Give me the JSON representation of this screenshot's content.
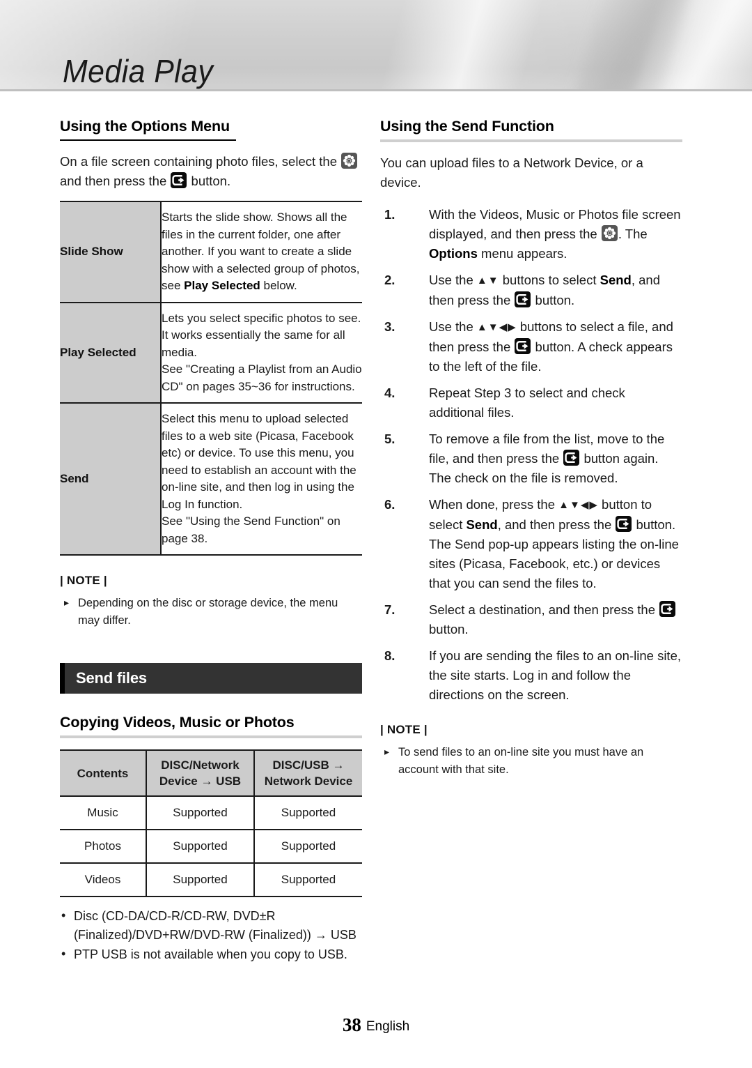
{
  "header": {
    "chapter_title": "Media Play"
  },
  "icons": {
    "gear": "gear-icon",
    "enter": "enter-icon",
    "arrow_updown": "▲▼",
    "arrow_all": "▲▼◀▶",
    "arrow_right": "→"
  },
  "left_column": {
    "heading": "Using the Options Menu",
    "intro_part1": "On a file screen containing photo files, select the",
    "intro_part2": "and then press the",
    "intro_part3": "button.",
    "options_table": {
      "rows": [
        {
          "label": "Slide Show",
          "desc_lead": "Starts the slide show. Shows all the files in the current folder, one after another. If you want to create a slide show with a selected group of photos, see",
          "desc_bold": "Play Selected",
          "desc_tail": "below."
        },
        {
          "label": "Play Selected",
          "desc_lead": "Lets you select specific photos to see. It works essentially the same for all media.",
          "desc_line2": "See \"Creating a Playlist from an Audio CD\" on pages 35~36 for instructions."
        },
        {
          "label": "Send",
          "desc_lead": "Select this menu to upload selected files to a web site (Picasa, Facebook etc) or device. To use this menu, you need to establish an account with the on-line site, and then log in using the Log In function.",
          "desc_line2": "See \"Using the Send Function\" on page 38."
        }
      ]
    },
    "note_label": "| NOTE |",
    "notes": [
      "Depending on the disc or storage device, the menu may differ."
    ],
    "section_bar_title": "Send files",
    "subheading2": "Copying Videos, Music or Photos",
    "contents_table": {
      "headers": [
        "Contents",
        "DISC/Network Device → USB",
        "DISC/USB → Network Device"
      ],
      "header_lines": [
        [
          "Contents"
        ],
        [
          "DISC/Network",
          "Device → USB"
        ],
        [
          "DISC/USB →",
          "Network Device"
        ]
      ],
      "rows": [
        {
          "content": "Music",
          "col2": "Supported",
          "col3": "Supported"
        },
        {
          "content": "Photos",
          "col2": "Supported",
          "col3": "Supported"
        },
        {
          "content": "Videos",
          "col2": "Supported",
          "col3": "Supported"
        }
      ]
    },
    "bullets": [
      "Disc (CD-DA/CD-R/CD-RW, DVD±R (Finalized)/DVD+RW/DVD-RW (Finalized)) → USB",
      "PTP USB is not available when you copy to USB."
    ]
  },
  "right_column": {
    "heading": "Using the Send Function",
    "intro": "You can upload files to a Network Device, or a device.",
    "steps": [
      {
        "num": "1.",
        "parts": [
          {
            "t": "text",
            "v": "With the Videos, Music or Photos file screen displayed, and then press the "
          },
          {
            "t": "icon",
            "v": "gear"
          },
          {
            "t": "text",
            "v": ". The "
          },
          {
            "t": "bold",
            "v": "Options"
          },
          {
            "t": "text",
            "v": " menu appears."
          }
        ]
      },
      {
        "num": "2.",
        "parts": [
          {
            "t": "text",
            "v": "Use the "
          },
          {
            "t": "arrow",
            "v": "▲▼"
          },
          {
            "t": "text",
            "v": " buttons to select "
          },
          {
            "t": "bold",
            "v": "Send"
          },
          {
            "t": "text",
            "v": ", and then press the "
          },
          {
            "t": "icon",
            "v": "enter"
          },
          {
            "t": "text",
            "v": " button."
          }
        ]
      },
      {
        "num": "3.",
        "parts": [
          {
            "t": "text",
            "v": "Use the "
          },
          {
            "t": "arrow",
            "v": "▲▼◀▶"
          },
          {
            "t": "text",
            "v": " buttons to select a file, and then press the "
          },
          {
            "t": "icon",
            "v": "enter"
          },
          {
            "t": "text",
            "v": " button. A check appears to the left of the file."
          }
        ]
      },
      {
        "num": "4.",
        "parts": [
          {
            "t": "text",
            "v": "Repeat Step 3 to select and check additional files."
          }
        ]
      },
      {
        "num": "5.",
        "parts": [
          {
            "t": "text",
            "v": "To remove a file from the list, move to the file, and then press the "
          },
          {
            "t": "icon",
            "v": "enter"
          },
          {
            "t": "text",
            "v": " button again."
          },
          {
            "t": "br",
            "v": ""
          },
          {
            "t": "text",
            "v": "The check on the file is removed."
          }
        ]
      },
      {
        "num": "6.",
        "parts": [
          {
            "t": "text",
            "v": "When done, press the "
          },
          {
            "t": "arrow",
            "v": "▲▼◀▶"
          },
          {
            "t": "text",
            "v": " button to select "
          },
          {
            "t": "bold",
            "v": "Send"
          },
          {
            "t": "text",
            "v": ", and then press the "
          },
          {
            "t": "icon",
            "v": "enter"
          },
          {
            "t": "text",
            "v": " button. The Send pop-up appears listing the on-line sites (Picasa, Facebook, etc.) or devices that you can send the files to."
          }
        ]
      },
      {
        "num": "7.",
        "parts": [
          {
            "t": "text",
            "v": "Select a destination, and then press the "
          },
          {
            "t": "icon",
            "v": "enter"
          },
          {
            "t": "text",
            "v": " button."
          }
        ]
      },
      {
        "num": "8.",
        "parts": [
          {
            "t": "text",
            "v": "If you are sending the files to an on-line site, the site starts. Log in and follow the directions on the screen."
          }
        ]
      }
    ],
    "note_label": "| NOTE |",
    "notes": [
      "To send files to an on-line site you must have an account with that site."
    ]
  },
  "footer": {
    "page_number": "38",
    "language": "English"
  }
}
